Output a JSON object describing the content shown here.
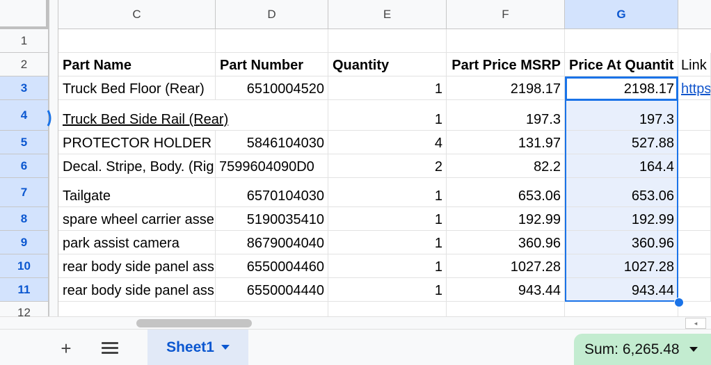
{
  "columns": [
    "C",
    "D",
    "E",
    "F",
    "G"
  ],
  "rows": [
    "1",
    "2",
    "3",
    "4",
    "5",
    "6",
    "7",
    "8",
    "9",
    "10",
    "11",
    "12"
  ],
  "header_row": {
    "part_name": "Part Name",
    "part_number": "Part Number",
    "quantity": "Quantity",
    "msrp": "Part Price MSRP",
    "price_at_qty": "Price At Quantit",
    "link": "Link"
  },
  "data_rows": [
    {
      "name": "Truck Bed Floor (Rear)",
      "number": "6510004520",
      "qty": "1",
      "msrp": "2198.17",
      "total": "2198.17",
      "link": "https"
    },
    {
      "name": "Truck Bed Side Rail (Rear)",
      "number": "",
      "qty": "1",
      "msrp": "197.3",
      "total": "197.3",
      "link": ""
    },
    {
      "name": "PROTECTOR HOLDER",
      "number": "5846104030",
      "qty": "4",
      "msrp": "131.97",
      "total": "527.88",
      "link": ""
    },
    {
      "name": "Decal. Stripe, Body. (Rig",
      "number": "7599604090D0",
      "qty": "2",
      "msrp": "82.2",
      "total": "164.4",
      "link": ""
    },
    {
      "name": "Tailgate",
      "number": "6570104030",
      "qty": "1",
      "msrp": "653.06",
      "total": "653.06",
      "link": ""
    },
    {
      "name": "spare wheel carrier asse",
      "number": "5190035410",
      "qty": "1",
      "msrp": "192.99",
      "total": "192.99",
      "link": ""
    },
    {
      "name": "park assist camera",
      "number": "8679004040",
      "qty": "1",
      "msrp": "360.96",
      "total": "360.96",
      "link": ""
    },
    {
      "name": "rear body side panel ass",
      "number": "6550004460",
      "qty": "1",
      "msrp": "1027.28",
      "total": "1027.28",
      "link": ""
    },
    {
      "name": "rear body side panel ass",
      "number": "6550004440",
      "qty": "1",
      "msrp": "943.44",
      "total": "943.44",
      "link": ""
    }
  ],
  "tabs": {
    "add_label": "+",
    "sheet1": "Sheet1",
    "sum": "Sum: 6,265.48"
  },
  "colors": {
    "accent": "#1a73e8",
    "selected_header": "#d3e3fd",
    "selected_range": "#e8effc",
    "sum_chip": "#c3ecd0",
    "link": "#1155cc"
  },
  "icons": [
    "add-sheet-icon",
    "all-sheets-icon",
    "dropdown-caret-icon",
    "scroll-right-icon"
  ]
}
